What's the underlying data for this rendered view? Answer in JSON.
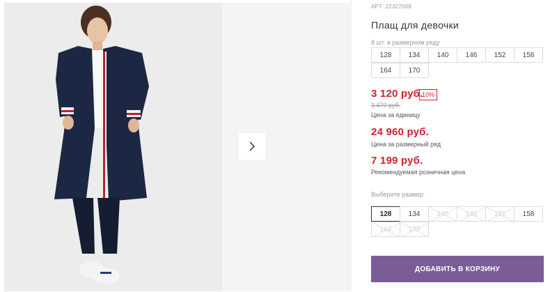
{
  "product": {
    "article": "АРТ: 22327009",
    "title": "Плащ для девочки",
    "size_note": "8 шт. в размерном ряду"
  },
  "size_row": [
    "128",
    "134",
    "140",
    "146",
    "152",
    "158",
    "164",
    "170"
  ],
  "pricing": {
    "unit_price": "3 120 руб.",
    "discount_badge": "10%",
    "old_price": "3 470 руб.",
    "unit_caption": "Цена за единицу",
    "row_price": "24 960 руб.",
    "row_caption": "Цена за размерный ряд",
    "retail_price": "7 199 руб.",
    "retail_caption": "Рекомендуемая розничная цена"
  },
  "size_select": {
    "label": "Выберите размер:",
    "options": [
      {
        "label": "128",
        "state": "selected"
      },
      {
        "label": "134",
        "state": "available"
      },
      {
        "label": "140",
        "state": "disabled"
      },
      {
        "label": "146",
        "state": "disabled"
      },
      {
        "label": "152",
        "state": "disabled"
      },
      {
        "label": "158",
        "state": "available"
      },
      {
        "label": "164",
        "state": "disabled"
      },
      {
        "label": "170",
        "state": "disabled"
      }
    ]
  },
  "cart": {
    "add_label": "ДОБАВИТЬ В КОРЗИНУ"
  },
  "gallery": {
    "next_icon": "chevron-right-icon"
  },
  "colors": {
    "price_red": "#d4202a",
    "button_purple": "#7a5d96"
  }
}
